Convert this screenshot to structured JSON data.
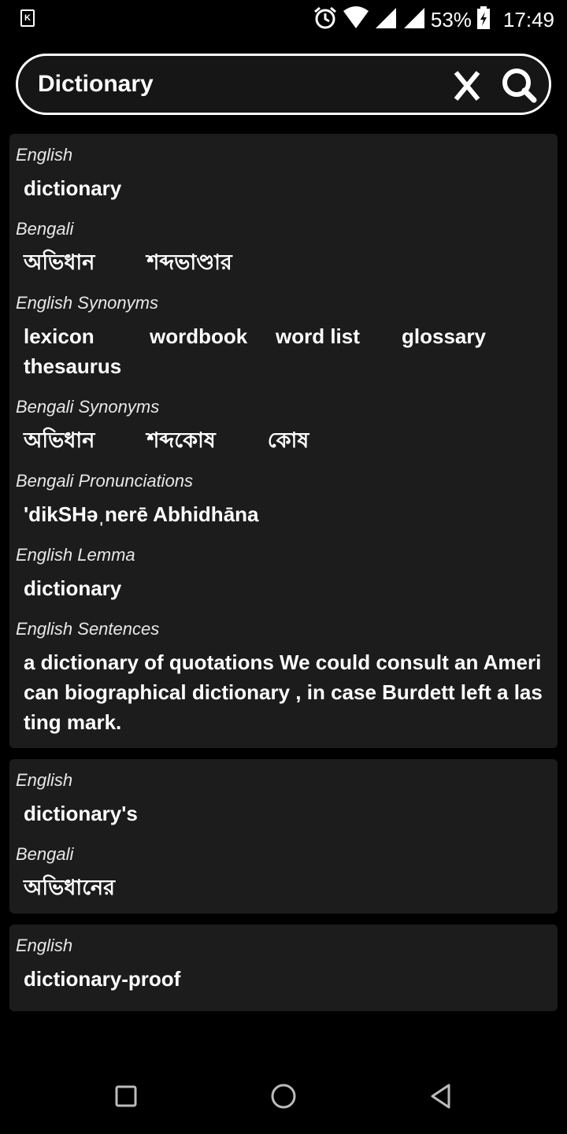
{
  "status_bar": {
    "app_icon_letter": "K",
    "battery": "53%",
    "time": "17:49"
  },
  "search": {
    "value": "Dictionary",
    "placeholder": "",
    "clear_label": "X"
  },
  "cards": [
    {
      "sections": [
        {
          "label": "English",
          "words": [
            "dictionary"
          ]
        },
        {
          "label": "Bengali",
          "words": [
            "অভিধান",
            "শব্দভাণ্ডার"
          ]
        },
        {
          "label": "English Synonyms",
          "words": [
            "lexicon",
            "wordbook",
            "word list",
            "glossary",
            "thesaurus"
          ]
        },
        {
          "label": "Bengali Synonyms",
          "words": [
            "অভিধান",
            "শব্দকোষ",
            "কোষ"
          ]
        },
        {
          "label": "Bengali Pronunciations",
          "text": "'dikSHəˌnerē Abhidhāna"
        },
        {
          "label": "English Lemma",
          "words": [
            "dictionary"
          ]
        },
        {
          "label": "English Sentences",
          "text": "a dictionary of quotations We could consult an American biographical dictionary , in case Burdett left a lasting mark."
        }
      ]
    },
    {
      "sections": [
        {
          "label": "English",
          "words": [
            "dictionary's"
          ]
        },
        {
          "label": "Bengali",
          "words": [
            "অভিধানের"
          ]
        }
      ]
    },
    {
      "sections": [
        {
          "label": "English",
          "words": [
            "dictionary-proof"
          ]
        }
      ]
    }
  ]
}
